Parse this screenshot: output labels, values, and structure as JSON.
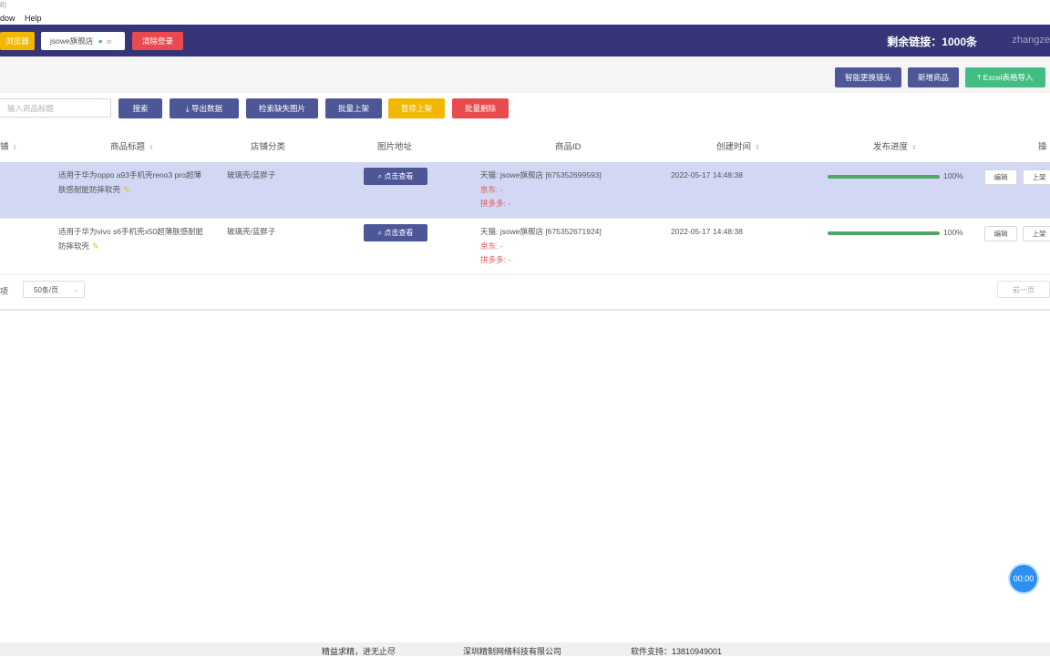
{
  "titlebar": {
    "text": "8)"
  },
  "menu": {
    "window": "dow",
    "help": "Help"
  },
  "header": {
    "left_button": "浏览器",
    "store_name": "jsowe旗舰店",
    "store_status": "in",
    "logout": "清除登录",
    "remaining": "剩余链接：1000条",
    "user": "zhangze"
  },
  "toolbar_top": {
    "smart_replace": "智能更换镜头",
    "add_product": "新增商品",
    "excel_import": "Excel表格导入"
  },
  "toolbar": {
    "search_placeholder": "输入商品标题",
    "search": "搜索",
    "export": "导出数据",
    "check_images": "检索缺失图片",
    "batch_up": "批量上架",
    "pause_up": "暂停上架",
    "batch_delete": "批量删除"
  },
  "table": {
    "headers": {
      "store": "铺",
      "title": "商品标题",
      "category": "店铺分类",
      "image": "图片地址",
      "product_id": "商品ID",
      "created": "创建时间",
      "progress": "发布进度",
      "ops": "操"
    },
    "rows": [
      {
        "title_line1": "适用于华为oppo a93手机壳reno3 pro超薄",
        "title_line2": "肤感耐脏防摔软壳",
        "category": "玻璃壳/蓝胖子",
        "view": "点击查看",
        "tmall": "天猫: jsowe旗舰店 [675352699593]",
        "jd": "京东: -",
        "pdd": "拼多多: -",
        "created": "2022-05-17 14:48:38",
        "progress": 100,
        "progress_label": "100%",
        "edit": "编辑",
        "shelf": "上架"
      },
      {
        "title_line1": "适用于华为vivo s6手机壳x50超薄肤感耐脏",
        "title_line2": "防摔软壳",
        "category": "玻璃壳/蓝胖子",
        "view": "点击查看",
        "tmall": "天猫: jsowe旗舰店 [675352671924]",
        "jd": "京东: -",
        "pdd": "拼多多: -",
        "created": "2022-05-17 14:48:38",
        "progress": 100,
        "progress_label": "100%",
        "edit": "编辑",
        "shelf": "上架"
      }
    ]
  },
  "pager": {
    "items_suffix": "项",
    "page_size": "50条/页",
    "prev": "前一页"
  },
  "footer": {
    "slogan": "精益求精，进无止尽",
    "company": "深圳精制网络科技有限公司",
    "support": "软件支持：13810949001"
  },
  "timer": "00:00",
  "colors": {
    "header_bg": "#353577",
    "primary": "#4d5797",
    "green": "#43bd84",
    "yellow": "#f2b800",
    "red": "#e84a4e",
    "selected_row": "#d2d7f3"
  }
}
